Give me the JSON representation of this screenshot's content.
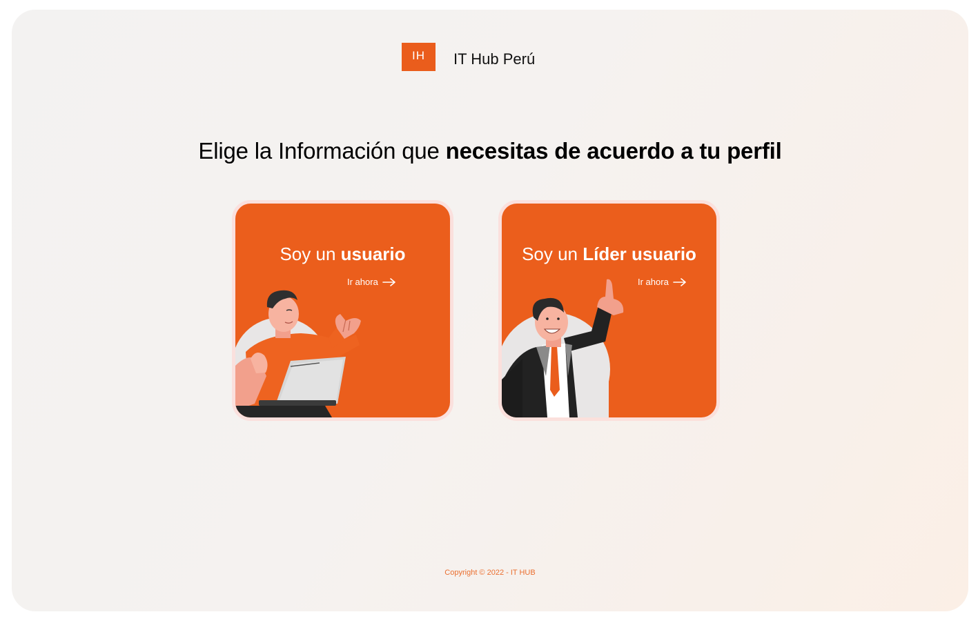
{
  "brand": {
    "logo_text": "IH",
    "name": "IT Hub Perú"
  },
  "headline": {
    "regular": "Elige la Información que ",
    "bold": "necesitas de acuerdo a tu perfil"
  },
  "cards": [
    {
      "title_regular": "Soy un ",
      "title_bold": "usuario",
      "cta": "Ir ahora",
      "icon": "arrow-right-icon",
      "illustration": "person-with-laptop-illustration"
    },
    {
      "title_regular": "Soy un ",
      "title_bold": "Líder usuario",
      "cta": "Ir ahora",
      "icon": "arrow-right-icon",
      "illustration": "businessman-pointing-up-illustration"
    }
  ],
  "footer": {
    "copyright": "Copyright © 2022 - IT HUB"
  },
  "colors": {
    "accent": "#eb5e1c",
    "text": "#000000",
    "footer": "#ea6e2e"
  }
}
